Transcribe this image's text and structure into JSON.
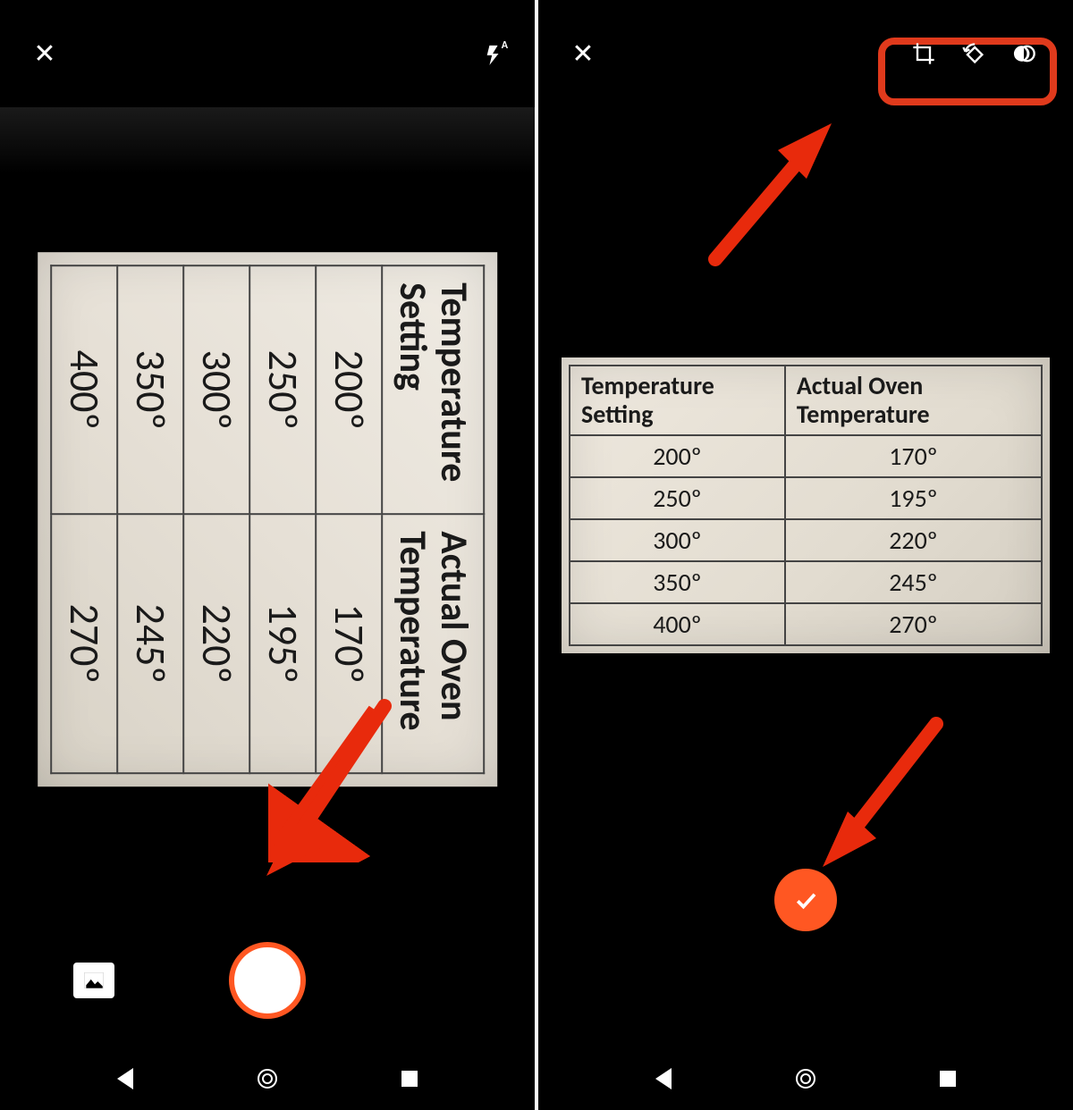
{
  "left": {
    "flash_mode": "A",
    "table": {
      "headers": [
        "Temperature Setting",
        "Actual Oven Temperature"
      ],
      "rows": [
        [
          "200º",
          "170º"
        ],
        [
          "250º",
          "195º"
        ],
        [
          "300º",
          "220º"
        ],
        [
          "350º",
          "245º"
        ],
        [
          "400º",
          "270º"
        ]
      ]
    }
  },
  "right": {
    "table": {
      "headers": [
        "Temperature Setting",
        "Actual Oven Temperature"
      ],
      "rows": [
        [
          "200º",
          "170º"
        ],
        [
          "250º",
          "195º"
        ],
        [
          "300º",
          "220º"
        ],
        [
          "350º",
          "245º"
        ],
        [
          "400º",
          "270º"
        ]
      ]
    }
  },
  "annotation": {
    "arrow_color": "#e82a0c",
    "highlight_color": "#e03a1c"
  }
}
